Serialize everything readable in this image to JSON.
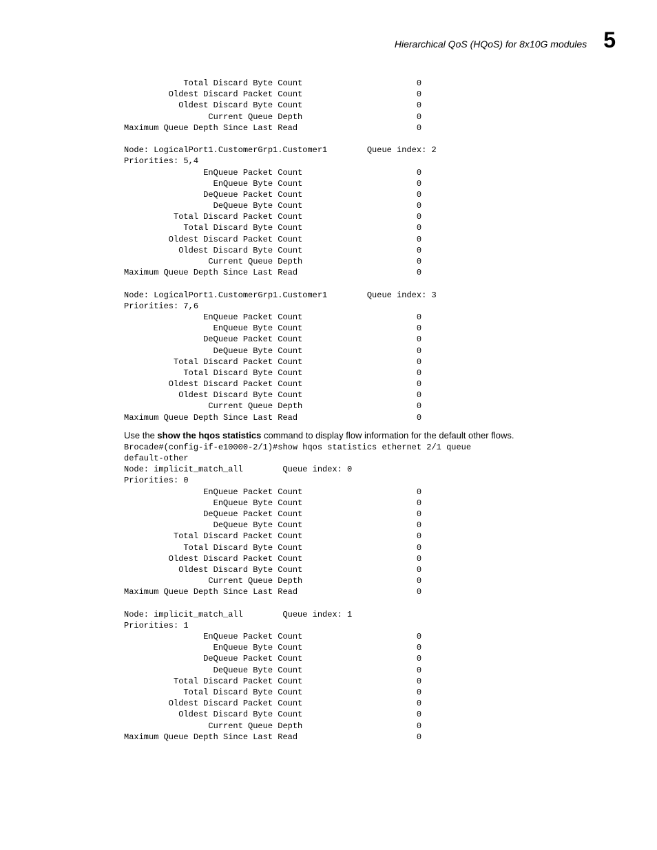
{
  "header": {
    "title": "Hierarchical QoS (HQoS) for 8x10G modules",
    "chapter": "5"
  },
  "block1": {
    "lines": [
      "            Total Discard Byte Count                       0",
      "         Oldest Discard Packet Count                       0",
      "           Oldest Discard Byte Count                       0",
      "                 Current Queue Depth                       0",
      "Maximum Queue Depth Since Last Read                        0",
      "",
      "Node: LogicalPort1.CustomerGrp1.Customer1        Queue index: 2",
      "Priorities: 5,4",
      "                EnQueue Packet Count                       0",
      "                  EnQueue Byte Count                       0",
      "                DeQueue Packet Count                       0",
      "                  DeQueue Byte Count                       0",
      "          Total Discard Packet Count                       0",
      "            Total Discard Byte Count                       0",
      "         Oldest Discard Packet Count                       0",
      "           Oldest Discard Byte Count                       0",
      "                 Current Queue Depth                       0",
      "Maximum Queue Depth Since Last Read                        0",
      "",
      "Node: LogicalPort1.CustomerGrp1.Customer1        Queue index: 3",
      "Priorities: 7,6",
      "                EnQueue Packet Count                       0",
      "                  EnQueue Byte Count                       0",
      "                DeQueue Packet Count                       0",
      "                  DeQueue Byte Count                       0",
      "          Total Discard Packet Count                       0",
      "            Total Discard Byte Count                       0",
      "         Oldest Discard Packet Count                       0",
      "           Oldest Discard Byte Count                       0",
      "                 Current Queue Depth                       0",
      "Maximum Queue Depth Since Last Read                        0"
    ]
  },
  "paragraph": {
    "pre": "Use the ",
    "bold": "show the hqos statistics",
    "post": " command to display flow information for the default other flows."
  },
  "block2": {
    "lines": [
      "Brocade#(config-if-e10000-2/1)#show hqos statistics ethernet 2/1 queue ",
      "default-other",
      "Node: implicit_match_all        Queue index: 0",
      "Priorities: 0",
      "                EnQueue Packet Count                       0",
      "                  EnQueue Byte Count                       0",
      "                DeQueue Packet Count                       0",
      "                  DeQueue Byte Count                       0",
      "          Total Discard Packet Count                       0",
      "            Total Discard Byte Count                       0",
      "         Oldest Discard Packet Count                       0",
      "           Oldest Discard Byte Count                       0",
      "                 Current Queue Depth                       0",
      "Maximum Queue Depth Since Last Read                        0",
      "",
      "Node: implicit_match_all        Queue index: 1",
      "Priorities: 1",
      "                EnQueue Packet Count                       0",
      "                  EnQueue Byte Count                       0",
      "                DeQueue Packet Count                       0",
      "                  DeQueue Byte Count                       0",
      "          Total Discard Packet Count                       0",
      "            Total Discard Byte Count                       0",
      "         Oldest Discard Packet Count                       0",
      "           Oldest Discard Byte Count                       0",
      "                 Current Queue Depth                       0",
      "Maximum Queue Depth Since Last Read                        0"
    ]
  }
}
